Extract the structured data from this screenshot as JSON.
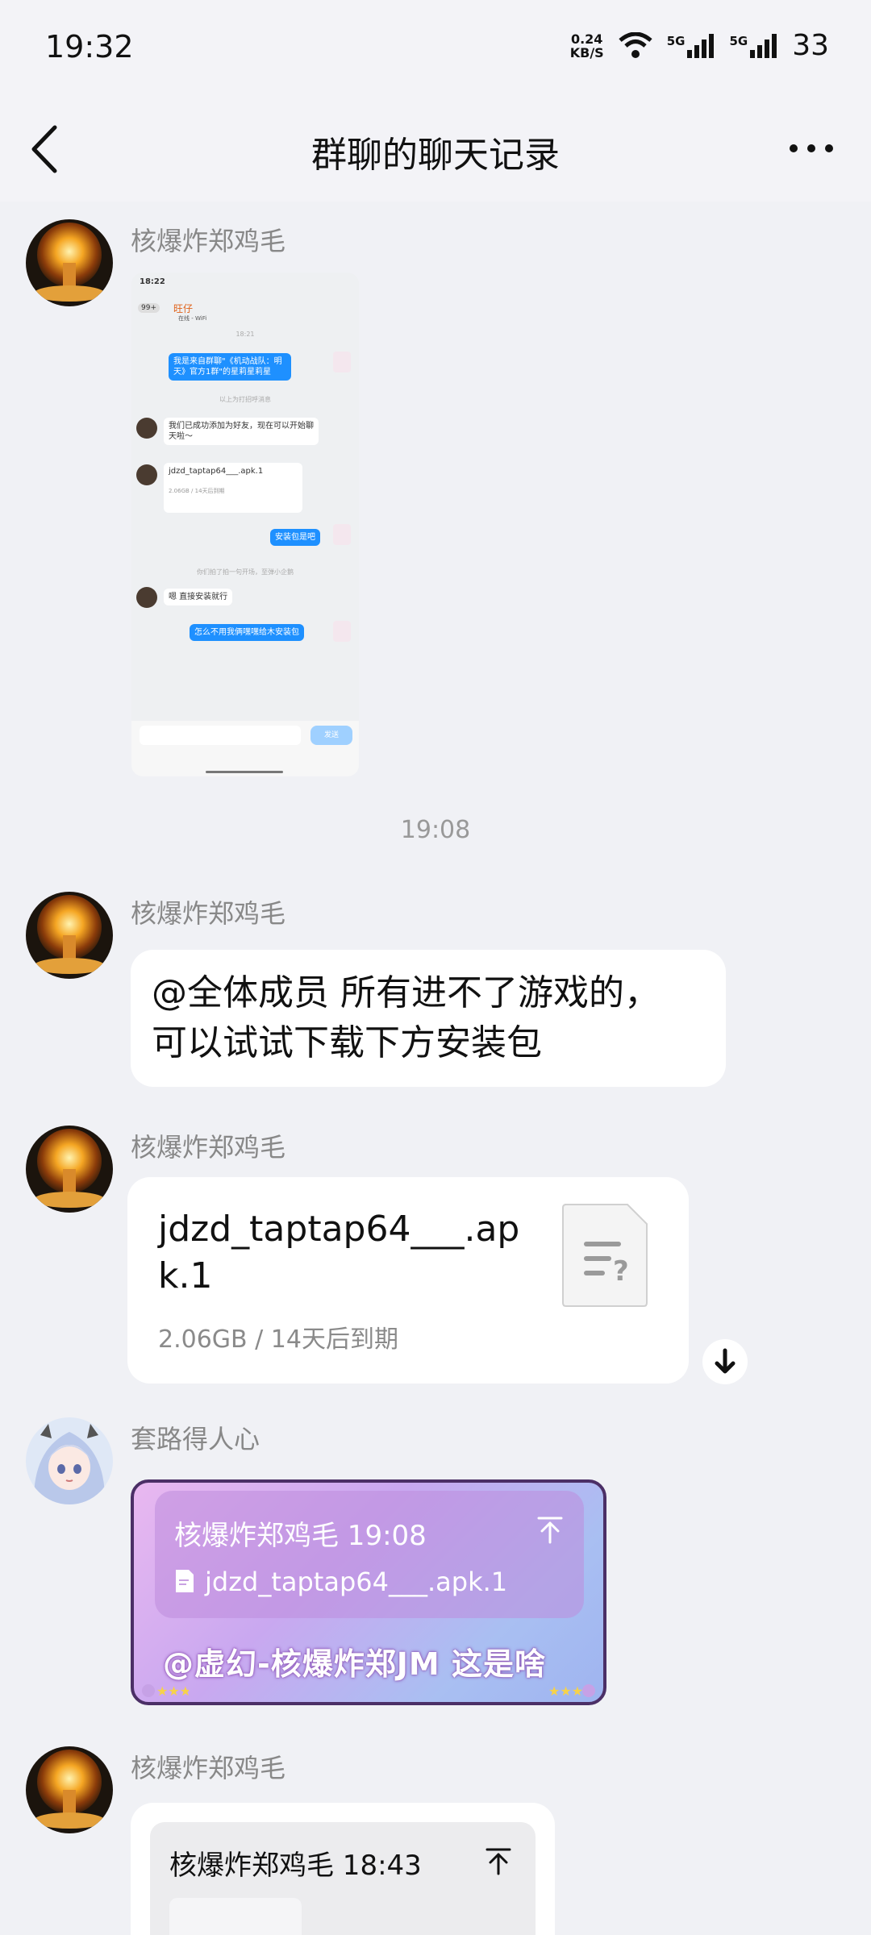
{
  "status_bar": {
    "time": "19:32",
    "speed_value": "0.24",
    "speed_unit": "KB/S",
    "net1": "5G",
    "net2": "5G",
    "battery": "33"
  },
  "header": {
    "title": "群聊的聊天记录"
  },
  "messages": [
    {
      "sender": "核爆炸郑鸡毛",
      "type": "image"
    },
    {
      "timestamp": "19:08"
    },
    {
      "sender": "核爆炸郑鸡毛",
      "type": "text",
      "lines": [
        "@全体成员 所有进不了游戏的，",
        "可以试试下载下方安装包"
      ]
    },
    {
      "sender": "核爆炸郑鸡毛",
      "type": "file",
      "file_name_line1": "jdzd_taptap64___.ap",
      "file_name_line2": "k.1",
      "file_meta": "2.06GB / 14天后到期"
    },
    {
      "sender": "套路得人心",
      "type": "reply",
      "quote_header": "核爆炸郑鸡毛 19:08",
      "quote_file": "jdzd_taptap64___.apk.1",
      "text": "@虚幻-核爆炸郑JM 这是啥"
    },
    {
      "sender": "核爆炸郑鸡毛",
      "type": "quote",
      "quote_header": "核爆炸郑鸡毛 18:43"
    }
  ],
  "screenshot": {
    "time": "18:22",
    "badge": "99+",
    "contact": "旺仔",
    "contact_status": "在线 - WiFi",
    "msg_time": "18:21",
    "msg1": "我是来自群聊\"《机动战队：明天》官方1群\"的星莉星莉星",
    "sys1": "以上为打招呼消息",
    "msg2": "我们已成功添加为好友，现在可以开始聊天啦～",
    "file_name": "jdzd_taptap64___.apk.1",
    "file_meta": "2.06GB / 14天后到期",
    "msg3": "安装包是吧",
    "sys2": "你们拍了拍一句开场，至弹小企鹅",
    "msg4": "嗯 直接安装就行",
    "msg5": "怎么不用我俩嘿嘿给木安装包",
    "send": "发送"
  },
  "colors": {
    "accent": "#1e90ff",
    "background": "#f0f1f5"
  }
}
